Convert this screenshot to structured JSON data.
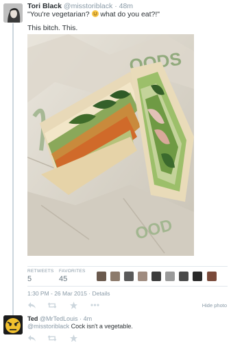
{
  "tweet1": {
    "name": "Tori Black",
    "handle": "@misstoriblack",
    "separator": "·",
    "time": "48m",
    "text_before_emoji": "\"You're vegetarian? ",
    "text_after_emoji": " what do you eat?!\"",
    "extra_text": "This bitch. This.",
    "stats": {
      "retweets_label": "RETWEETS",
      "retweets_value": "5",
      "favorites_label": "FAVORITES",
      "favorites_value": "45"
    },
    "timestamp": "1:30 PM - 26 Mar 2015 · Details",
    "hide_photo": "Hide photo"
  },
  "tweet2": {
    "name": "Ted",
    "handle": "@MrTedLouis",
    "separator": "·",
    "time": "4m",
    "mention": "@misstoriblack",
    "text": " Cock isn't a vegetable."
  },
  "colors": {
    "text": "#292f33",
    "muted": "#8899a6",
    "icon": "#ccd6dd",
    "emoji": "#f6c343"
  },
  "icons": {
    "reply": "reply-icon",
    "retweet": "retweet-icon",
    "favorite": "star-icon",
    "more": "more-icon"
  }
}
